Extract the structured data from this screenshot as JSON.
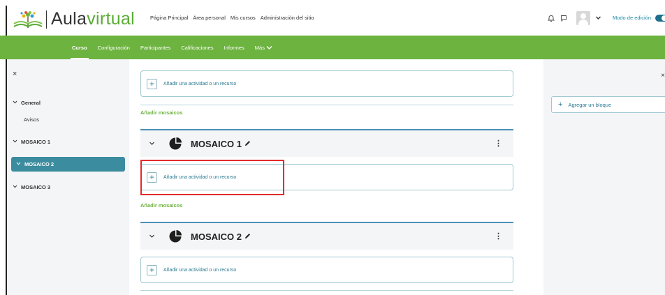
{
  "brand": {
    "prefix": "Aula",
    "suffix": "virtual"
  },
  "topnav": [
    "Página Principal",
    "Área personal",
    "Mis cursos",
    "Administración del sitio"
  ],
  "top_right": {
    "edit_mode_label": "Modo de edición",
    "bell_icon": "bell-icon",
    "chat_icon": "chat-icon"
  },
  "secnav": {
    "items": [
      "Curso",
      "Configuración",
      "Participantes",
      "Calificaciones",
      "Informes"
    ],
    "more": "Más",
    "active": "Curso"
  },
  "course_index": {
    "close": "×",
    "sections": [
      {
        "label": "General",
        "children": [
          "Avisos"
        ]
      },
      {
        "label": "MOSAICO 1",
        "children": []
      },
      {
        "label": "MOSAICO 2",
        "children": []
      },
      {
        "label": "MOSAICO 3",
        "children": []
      }
    ]
  },
  "main": {
    "add_activity_label": "Añadir una actividad o un recurso",
    "add_mosaics_label": "Añadir mosaicos",
    "sections": [
      {
        "title": "MOSAICO 1"
      },
      {
        "title": "MOSAICO 2"
      }
    ]
  },
  "blocks": {
    "close": "×",
    "add_block_label": "Agregar un bloque"
  }
}
